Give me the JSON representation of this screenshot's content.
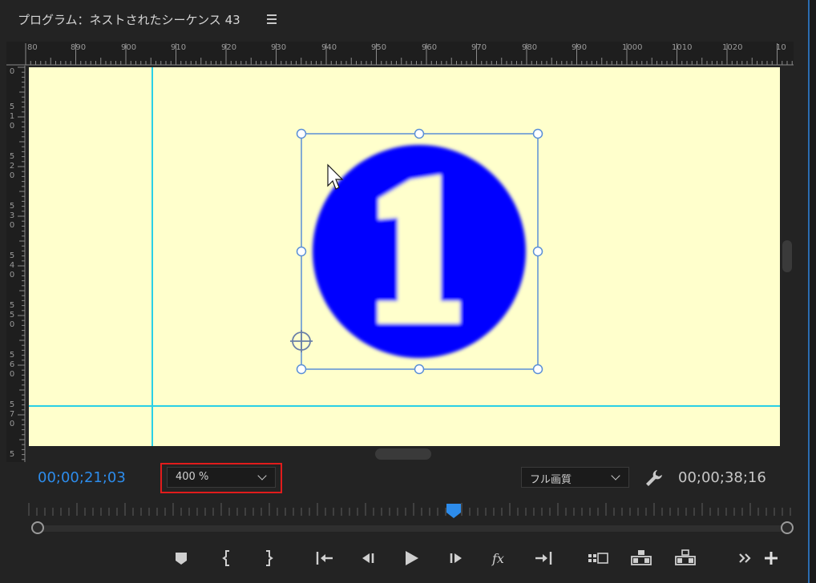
{
  "panel": {
    "title": "プログラム：ネストされたシーケンス 43"
  },
  "ruler": {
    "top_labels": [
      "80",
      "890",
      "900",
      "910",
      "920",
      "930",
      "940",
      "950",
      "960",
      "970",
      "980",
      "990",
      "1000",
      "1010",
      "1020",
      "10"
    ],
    "left_labels": [
      "0",
      "510",
      "520",
      "530",
      "540",
      "550",
      "560",
      "570",
      "5"
    ]
  },
  "playback": {
    "current_timecode": "00;00;21;03",
    "duration_timecode": "00;00;38;16",
    "zoom_value": "400 %",
    "quality_value": "フル画質",
    "playhead_position": 0.555
  },
  "icons": {
    "panel_menu": "hamburger-icon",
    "settings": "wrench-icon",
    "marker": "marker-icon",
    "mark_in": "mark-in-icon",
    "mark_out": "mark-out-icon",
    "go_to_in": "go-to-in-icon",
    "step_back": "step-back-icon",
    "play": "play-icon",
    "step_forward": "step-forward-icon",
    "fx": "fx-icon",
    "go_to_out": "go-to-out-icon",
    "compare": "comparison-view-icon",
    "lift": "lift-icon",
    "extract": "extract-icon",
    "more": "more-icon",
    "add": "plus-icon"
  },
  "colors": {
    "accent": "#2d8ceb",
    "canvas_bg": "#ffffcc",
    "guide": "#29d0e6",
    "badge_fill": "#0000ff",
    "highlight": "#e11c1c"
  }
}
